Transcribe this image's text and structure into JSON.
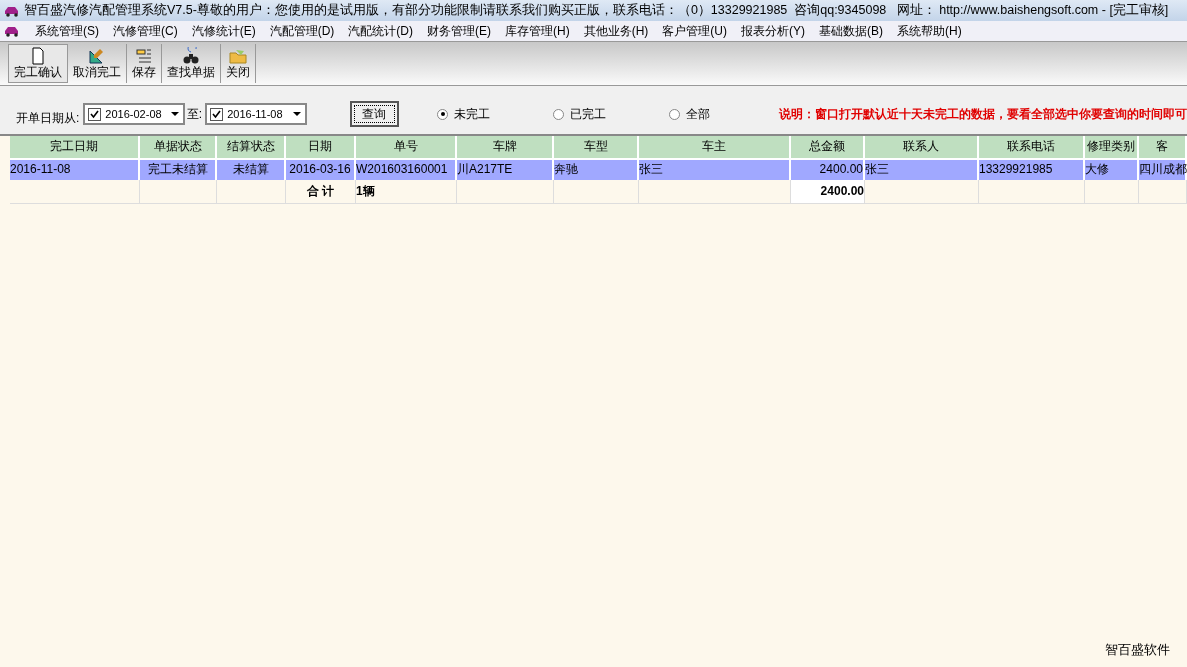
{
  "window": {
    "title": "智百盛汽修汽配管理系统V7.5-尊敬的用户：您使用的是试用版，有部分功能限制请联系我们购买正版，联系电话：（0）13329921985  咨询qq:9345098   网址： http://www.baishengsoft.com - [完工审核]"
  },
  "menu": [
    "系统管理(S)",
    "汽修管理(C)",
    "汽修统计(E)",
    "汽配管理(D)",
    "汽配统计(D)",
    "财务管理(E)",
    "库存管理(H)",
    "其他业务(H)",
    "客户管理(U)",
    "报表分析(Y)",
    "基础数据(B)",
    "系统帮助(H)"
  ],
  "toolbar": [
    {
      "label": "完工确认",
      "kind": "page",
      "selected": true
    },
    {
      "label": "取消完工",
      "kind": "ruler",
      "selected": false
    },
    {
      "label": "保存",
      "kind": "save",
      "selected": false
    },
    {
      "label": "查找单据",
      "kind": "find",
      "selected": false
    },
    {
      "label": "关闭",
      "kind": "folder",
      "selected": false
    }
  ],
  "filter": {
    "label": "开单日期从:",
    "from": {
      "value": "2016-02-08",
      "checked": true
    },
    "to_label": "至:",
    "to": {
      "value": "2016-11-08",
      "checked": true
    },
    "query_button": "查询",
    "options": [
      {
        "label": "未完工",
        "selected": true
      },
      {
        "label": "已完工",
        "selected": false
      },
      {
        "label": "全部",
        "selected": false
      }
    ],
    "note": "说明：窗口打开默认近十天未完工的数据，要看全部选中你要查询的时间即可"
  },
  "table": {
    "columns": [
      "完工日期",
      "单据状态",
      "结算状态",
      "日期",
      "单号",
      "车牌",
      "车型",
      "车主",
      "总金额",
      "联系人",
      "联系电话",
      "修理类别",
      "客"
    ],
    "rows": [
      {
        "selected": true,
        "cells": [
          "2016-11-08",
          "完工未结算",
          "未结算",
          "2016-03-16",
          "W201603160001",
          "川A217TE",
          "奔驰",
          "张三",
          "2400.00",
          "张三",
          "13329921985",
          "大修",
          "四川成都"
        ]
      }
    ],
    "total": {
      "label": "合 计",
      "count": "1辆",
      "amount": "2400.00"
    }
  },
  "footer": "智百盛软件"
}
